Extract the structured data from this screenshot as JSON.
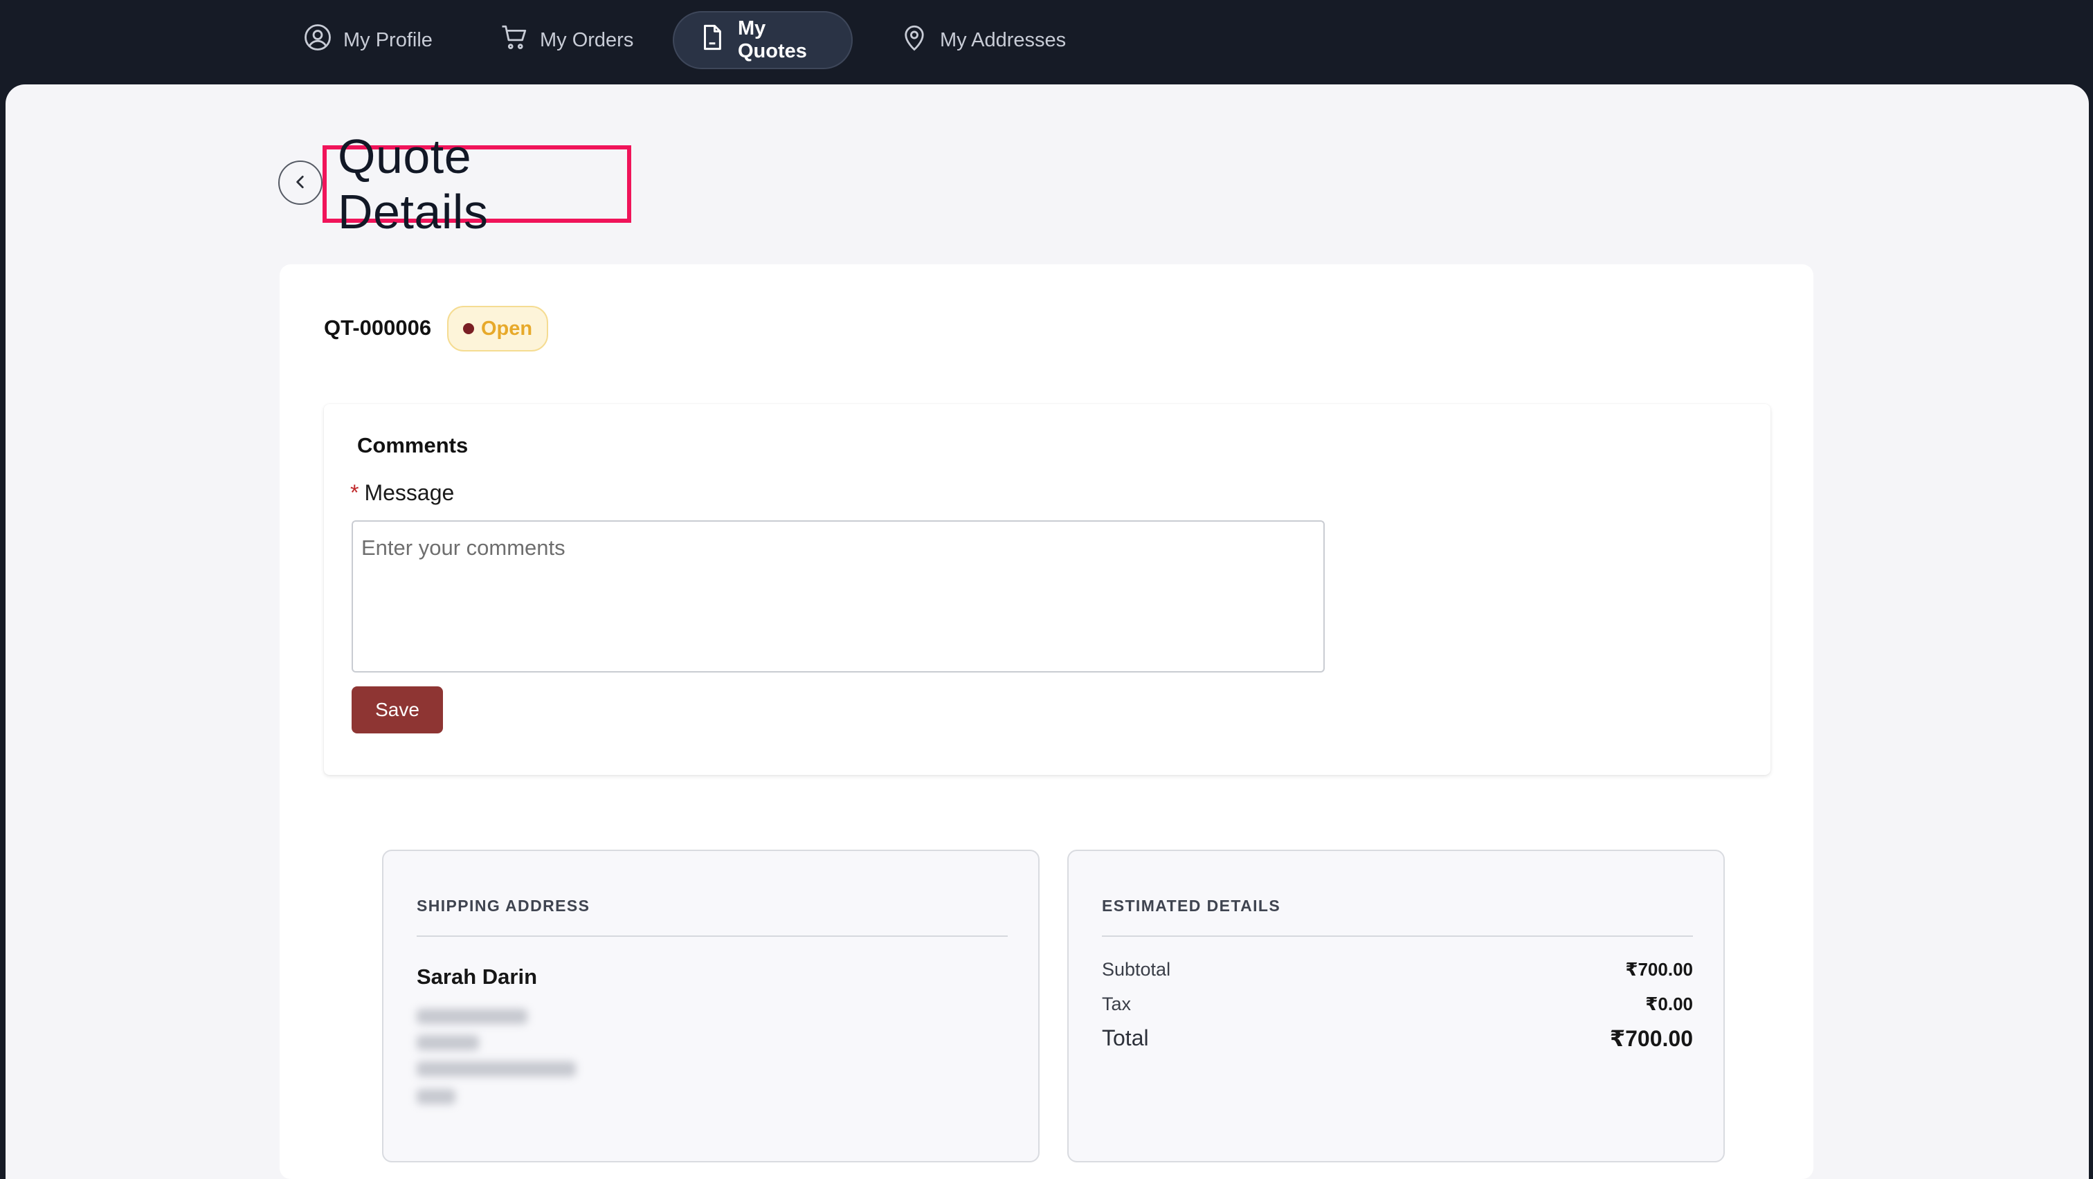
{
  "nav": {
    "items": [
      {
        "label": "My Profile",
        "icon": "user-circle-icon",
        "active": false
      },
      {
        "label": "My Orders",
        "icon": "cart-icon",
        "active": false
      },
      {
        "label": "My Quotes",
        "icon": "document-icon",
        "active": true
      },
      {
        "label": "My Addresses",
        "icon": "map-pin-icon",
        "active": false
      }
    ]
  },
  "page": {
    "title": "Quote Details",
    "back_icon": "chevron-left-icon"
  },
  "quote": {
    "id": "QT-000006",
    "status": "Open",
    "status_color": "#e7a92a"
  },
  "comments": {
    "title": "Comments",
    "required_mark": "*",
    "message_label": "Message",
    "placeholder": "Enter your comments",
    "value": "",
    "save_label": "Save"
  },
  "shipping": {
    "heading": "SHIPPING ADDRESS",
    "name": "Sarah Darin"
  },
  "estimate": {
    "heading": "ESTIMATED DETAILS",
    "subtotal_label": "Subtotal",
    "subtotal_value": "₹700.00",
    "tax_label": "Tax",
    "tax_value": "₹0.00",
    "total_label": "Total",
    "total_value": "₹700.00"
  },
  "colors": {
    "nav_bg": "#161b26",
    "accent_button": "#8e3533",
    "highlight_border": "#f0145a",
    "badge_bg": "#fdf4d9"
  }
}
